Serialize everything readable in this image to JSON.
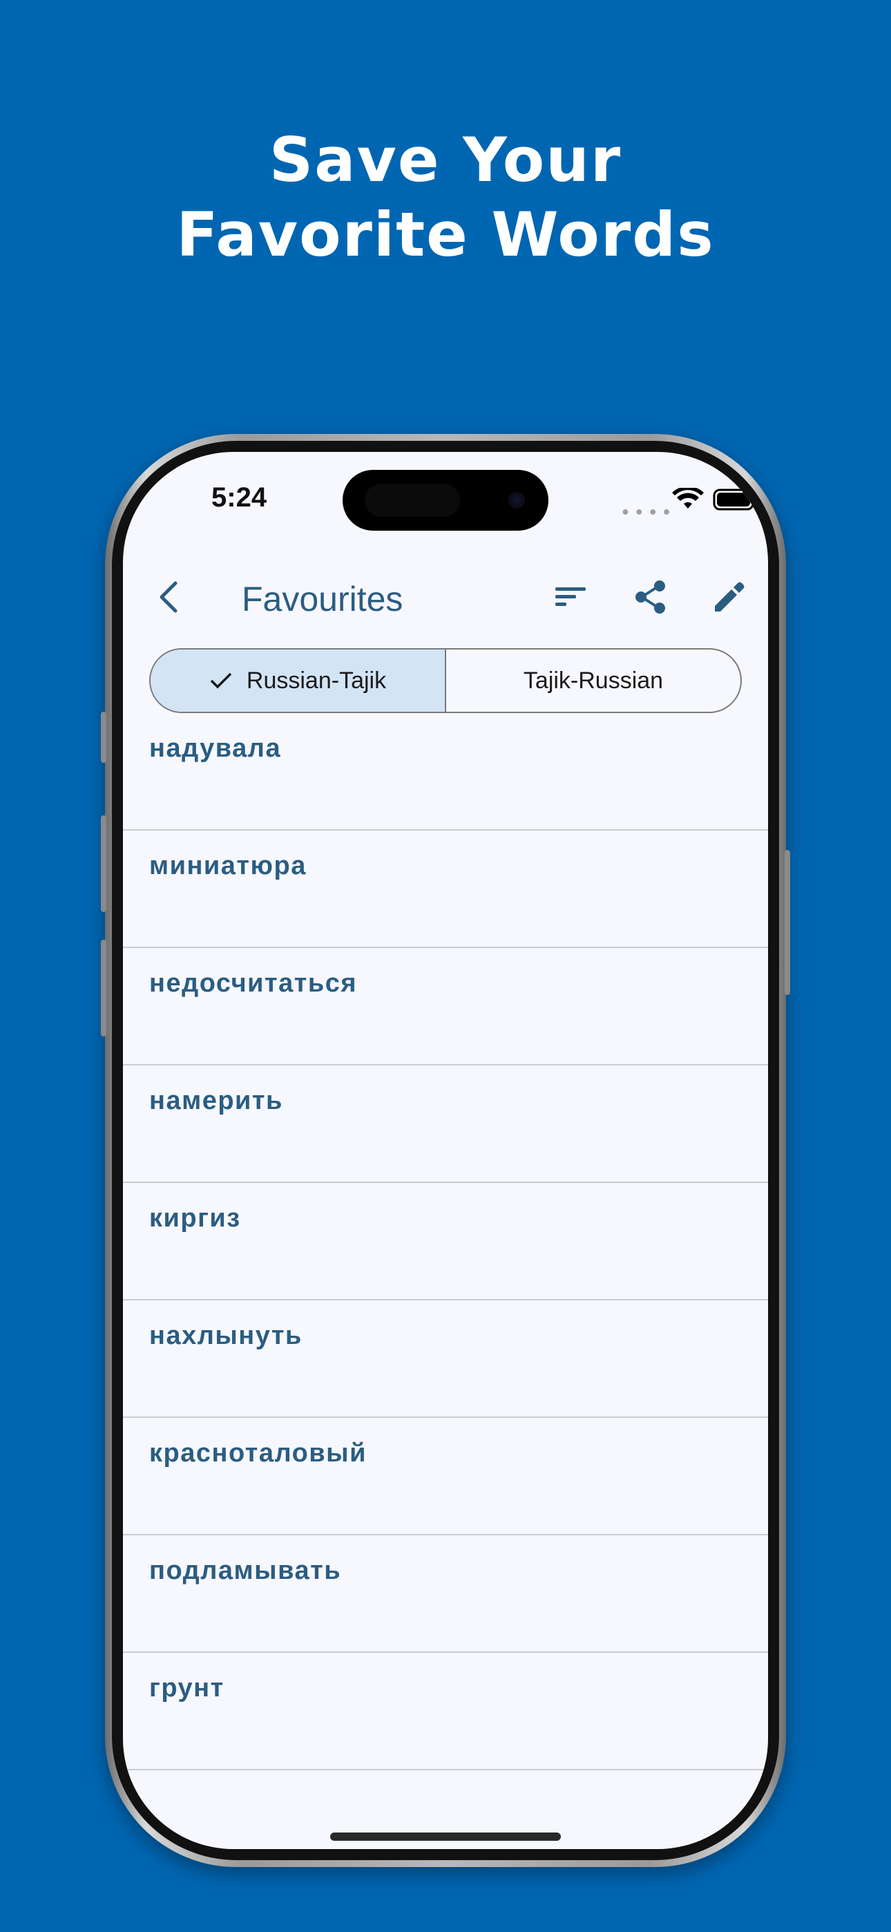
{
  "headline": {
    "line1": "Save Your",
    "line2": "Favorite Words"
  },
  "status_bar": {
    "time": "5:24"
  },
  "appbar": {
    "title": "Favourites",
    "icons": [
      "back-arrow-icon",
      "sort-icon",
      "share-icon",
      "edit-pencil-icon"
    ]
  },
  "segmented": {
    "options": [
      "Russian-Tajik",
      "Tajik-Russian"
    ],
    "selected": "Russian-Tajik"
  },
  "words": [
    "надувала",
    "миниатюра",
    "недосчитаться",
    "намерить",
    "киргиз",
    "нахлынуть",
    "красноталовый",
    "подламывать",
    "грунт"
  ],
  "colors": {
    "background": "#0066b2",
    "accent_text": "#2b5d82",
    "selected_segment": "#d3e4f5",
    "screen_bg": "#f7f8fd"
  }
}
